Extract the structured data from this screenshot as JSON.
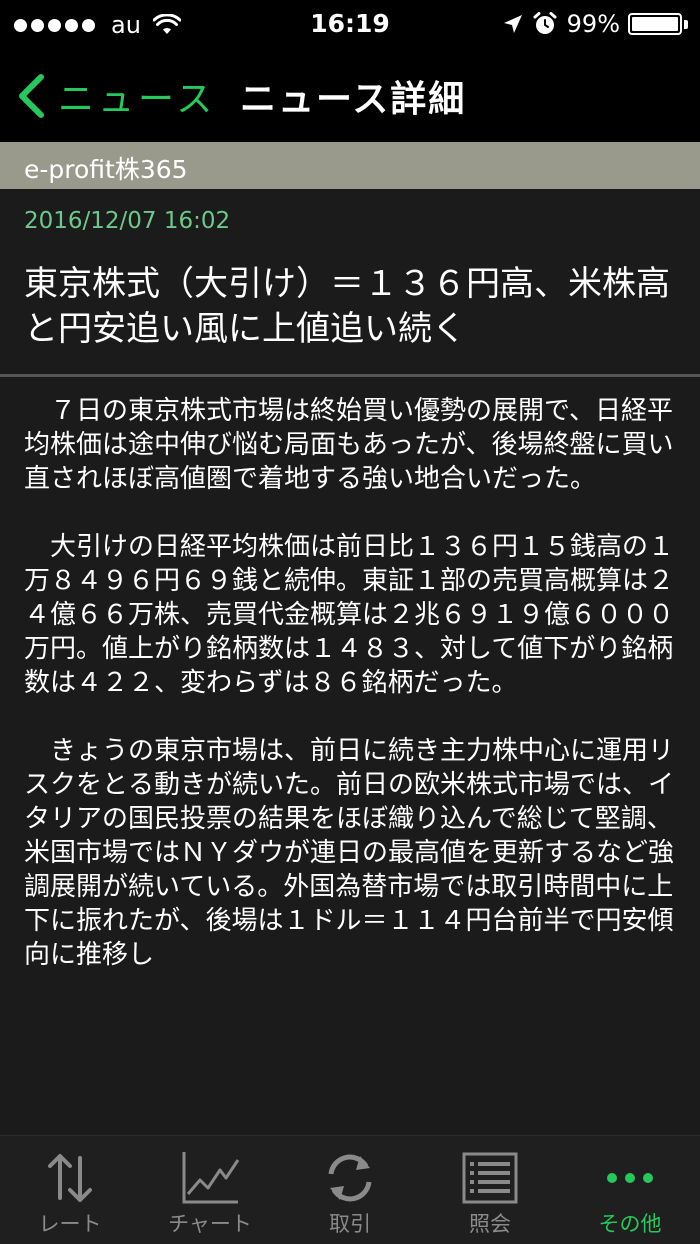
{
  "status_bar": {
    "carrier": "au",
    "time": "16:19",
    "battery_percent": "99%",
    "battery_level": 0.99,
    "icons": [
      "signal-dots-icon",
      "wifi-icon",
      "location-arrow-icon",
      "alarm-clock-icon",
      "battery-icon"
    ]
  },
  "nav": {
    "back_label": "ニュース",
    "title": "ニュース詳細"
  },
  "source": "e-profit株365",
  "article": {
    "date": "2016/12/07 16:02",
    "headline": "東京株式（大引け）＝１３６円高、米株高と円安追い風に上値追い続く",
    "paragraphs": [
      "　７日の東京株式市場は終始買い優勢の展開で、日経平均株価は途中伸び悩む局面もあったが、後場終盤に買い直されほぼ高値圏で着地する強い地合いだった。",
      "　大引けの日経平均株価は前日比１３６円１５銭高の１万８４９６円６９銭と続伸。東証１部の売買高概算は２４億６６万株、売買代金概算は２兆６９１９億６０００万円。値上がり銘柄数は１４８３、対して値下がり銘柄数は４２２、変わらずは８６銘柄だった。",
      "　きょうの東京市場は、前日に続き主力株中心に運用リスクをとる動きが続いた。前日の欧米株式市場では、イタリアの国民投票の結果をほぼ織り込んで総じて堅調、米国市場ではＮＹダウが連日の最高値を更新するなど強調展開が続いている。外国為替市場では取引時間中に上下に振れたが、後場は１ドル＝１１４円台前半で円安傾向に推移し"
    ]
  },
  "tabs": [
    {
      "label": "レート",
      "icon": "rate-arrows-icon",
      "active": false
    },
    {
      "label": "チャート",
      "icon": "chart-icon",
      "active": false
    },
    {
      "label": "取引",
      "icon": "refresh-icon",
      "active": false
    },
    {
      "label": "照会",
      "icon": "list-icon",
      "active": false
    },
    {
      "label": "その他",
      "icon": "more-dots-icon",
      "active": true
    }
  ],
  "colors": {
    "accent": "#24c85b",
    "date": "#6cc98a",
    "source_bar": "#9a9a8c",
    "background": "#1b1b1b"
  }
}
